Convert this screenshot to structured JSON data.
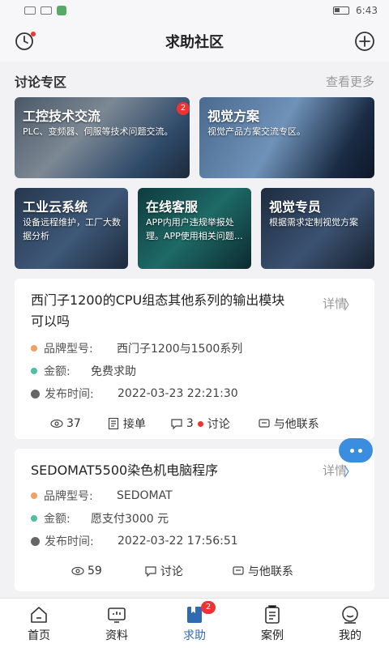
{
  "status": {
    "time": "6:43"
  },
  "header": {
    "title": "求助社区"
  },
  "section": {
    "title": "讨论专区",
    "more": "查看更多"
  },
  "tiles": [
    {
      "title": "工控技术交流",
      "desc": "PLC、变频器、伺服等技术问题交流。",
      "badge": "2"
    },
    {
      "title": "视觉方案",
      "desc": "视觉产品方案交流专区。"
    },
    {
      "title": "工业云系统",
      "desc": "设备远程维护，工厂大数据分析"
    },
    {
      "title": "在线客服",
      "desc": "APP内用户违规举报处理。APP使用相关问题…"
    },
    {
      "title": "视觉专员",
      "desc": "根据需求定制视觉方案"
    }
  ],
  "posts": [
    {
      "title": "西门子1200的CPU组态其他系列的输出模块可以吗",
      "detail": "详情",
      "brand_label": "品牌型号:",
      "brand": "西门子1200与1500系列",
      "amount_label": "金额:",
      "amount": "免费求助",
      "time_label": "发布时间:",
      "time": "2022-03-23 22:21:30",
      "views": "37",
      "take_order": "接单",
      "comments": "3",
      "discuss": "讨论",
      "contact": "与他联系"
    },
    {
      "title": "SEDOMAT5500染色机电脑程序",
      "detail": "详情",
      "brand_label": "品牌型号:",
      "brand": "SEDOMAT",
      "amount_label": "金额:",
      "amount": "愿支付3000 元",
      "time_label": "发布时间:",
      "time": "2022-03-22 17:56:51",
      "views": "59",
      "discuss": "讨论",
      "contact": "与他联系"
    }
  ],
  "tabbar": {
    "items": [
      {
        "label": "首页",
        "icon": "home-icon"
      },
      {
        "label": "资料",
        "icon": "monitor-icon"
      },
      {
        "label": "求助",
        "icon": "bookmark-icon",
        "badge": "2"
      },
      {
        "label": "案例",
        "icon": "clipboard-icon"
      },
      {
        "label": "我的",
        "icon": "smile-icon"
      }
    ],
    "active": "求助"
  },
  "colors": {
    "accent": "#2f6bb0",
    "badge": "#e33333",
    "fab": "#3b8de0"
  }
}
